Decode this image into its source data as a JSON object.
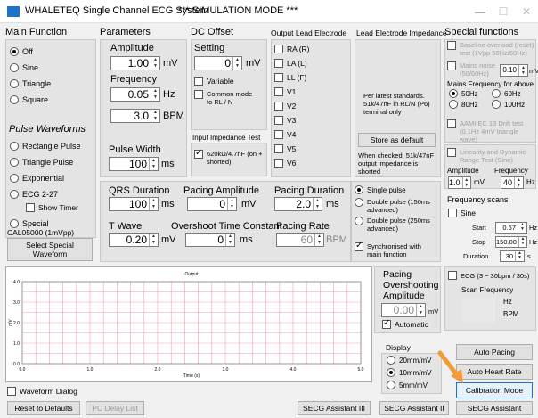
{
  "window": {
    "title": "WHALETEQ Single Channel ECG System",
    "mode": "*** SIMULATION MODE ***",
    "min_glyph": "—",
    "max_glyph": "☐",
    "close_glyph": "✕"
  },
  "headers": {
    "main_function": "Main Function",
    "parameters": "Parameters",
    "dc_offset": "DC Offset",
    "output_lead": "Output Lead Electrode",
    "lead_impedance": "Lead Electrode Impedance",
    "special_functions": "Special functions"
  },
  "main_function": {
    "options": [
      "Off",
      "Sine",
      "Triangle",
      "Square"
    ],
    "selected": "Off",
    "pulse_title": "Pulse Waveforms",
    "pulse_options": [
      "Rectangle Pulse",
      "Triangle Pulse",
      "Exponential",
      "ECG 2-27"
    ],
    "show_timer": "Show Timer",
    "special": "Special",
    "special_value": "CAL05000 (1mVpp)",
    "select_special": "Select Special Waveform"
  },
  "parameters": {
    "amplitude_label": "Amplitude",
    "amplitude": "1.00",
    "amplitude_unit": "mV",
    "frequency_label": "Frequency",
    "frequency": "0.05",
    "frequency_unit": "Hz",
    "bpm": "3.0",
    "bpm_unit": "BPM",
    "pulse_width_label": "Pulse Width",
    "pulse_width": "100",
    "pulse_width_unit": "ms"
  },
  "dc_offset": {
    "setting_label": "Setting",
    "setting": "0",
    "setting_unit": "mV",
    "variable": "Variable",
    "common_mode": "Common mode to RL / N",
    "input_impedance": "Input Impedance Test",
    "impedance_option": "620kΩ/4.7nF (on + shorted)"
  },
  "output_lead": {
    "leads": [
      "RA (R)",
      "LA (L)",
      "LL (F)",
      "V1",
      "V2",
      "V3",
      "V4",
      "V5",
      "V6"
    ]
  },
  "lead_impedance": {
    "note": "Per latest standards. 51k/47nF in RL/N (P6) terminal only",
    "store_default": "Store as default",
    "checked_note": "When checked, 51k/47nF output impedance is shorted"
  },
  "special_functions": {
    "baseline": "Baseline overload (reset) test (1Vpp 50Hz/60Hz)",
    "mains_noise": "Mains noise (50/60Hz)",
    "mains_noise_value": "0.10",
    "mains_noise_unit": "mV",
    "mains_freq_title": "Mains Frequency for above",
    "freqs": [
      "50Hz",
      "60Hz",
      "80Hz",
      "100Hz"
    ],
    "freq_selected": "50Hz",
    "aami": "AAMI EC 13 Drift test (0.1Hz 4mV triangle wave)",
    "linearity": "Linearity and Dynamic Range Test (Sine)",
    "amplitude_label": "Amplitude",
    "frequency_label": "Frequency",
    "lin_amp": "1.0",
    "lin_amp_unit": "mV",
    "lin_freq": "40",
    "lin_freq_unit": "Hz",
    "freq_scans": "Frequency scans",
    "sine": "Sine",
    "start_label": "Start",
    "start": "0.67",
    "start_unit": "Hz",
    "stop_label": "Stop",
    "stop": "150.00",
    "stop_unit": "Hz",
    "duration_label": "Duration",
    "duration": "30",
    "duration_unit": "s",
    "ecg_scan": "ECG (3 ~ 30bpm / 30s)",
    "scan_frequency": "Scan Frequency",
    "hz": "Hz",
    "bpm": "BPM"
  },
  "qrs": {
    "qrs_label": "QRS Duration",
    "qrs": "100",
    "qrs_unit": "ms",
    "pacing_amp_label": "Pacing Amplitude",
    "pacing_amp": "0",
    "pacing_amp_unit": "mV",
    "pacing_dur_label": "Pacing Duration",
    "pacing_dur": "2.0",
    "pacing_dur_unit": "ms",
    "twave_label": "T Wave",
    "twave": "0.20",
    "twave_unit": "mV",
    "overshoot_tc_label": "Overshoot Time Constant",
    "overshoot_tc": "0",
    "overshoot_tc_unit": "ms",
    "pacing_rate_label": "Pacing Rate",
    "pacing_rate": "60",
    "pacing_rate_unit": "BPM"
  },
  "pulse_mode": {
    "single": "Single pulse",
    "double150": "Double pulse (150ms advanced)",
    "double250": "Double pulse (250ms advanced)",
    "synced": "Synchronised with main function"
  },
  "pacing_overshoot": {
    "title": "Pacing Overshooting Amplitude",
    "value": "0.00",
    "unit": "mV",
    "automatic": "Automatic"
  },
  "display": {
    "title": "Display",
    "options": [
      "20mm/mV",
      "10mm/mV",
      "5mm/mV"
    ],
    "selected": "10mm/mV"
  },
  "chart_data": {
    "type": "line",
    "title": "Output",
    "xlabel": "Time (s)",
    "ylabel": "mV",
    "xlim": [
      0,
      5
    ],
    "ylim": [
      0,
      4
    ],
    "x_ticks": [
      "0.0",
      "1.0",
      "2.0",
      "3.0",
      "4.0",
      "5.0"
    ],
    "y_ticks": [
      "0.0",
      "1.0",
      "2.0",
      "3.0",
      "4.0"
    ],
    "grid": true,
    "series": []
  },
  "buttons": {
    "auto_pacing": "Auto Pacing",
    "auto_heart_rate": "Auto Heart Rate",
    "calibration": "Calibration Mode",
    "waveform_dialog": "Waveform Dialog",
    "reset": "Reset to Defaults",
    "pc_delay": "PC Delay List",
    "secg1": "SECG Assistant III",
    "secg2": "SECG Assistant II",
    "secg3": "SECG Assistant"
  },
  "colors": {
    "grid": "#f4a0b0",
    "arrow": "#f39a3a",
    "accent": "#1e73c8"
  }
}
